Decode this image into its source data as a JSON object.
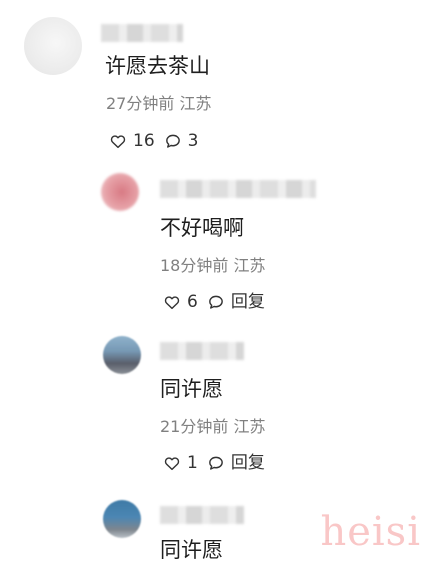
{
  "comments": [
    {
      "text": "许愿去茶山",
      "meta": "27分钟前 江苏",
      "actions": {
        "like_count": "16",
        "comment_count": "3"
      }
    }
  ],
  "replies": [
    {
      "text": "不好喝啊",
      "meta": "18分钟前 江苏",
      "actions": {
        "like_count": "6",
        "reply_label": "回复"
      }
    },
    {
      "text": "同许愿",
      "meta": "21分钟前 江苏",
      "actions": {
        "like_count": "1",
        "reply_label": "回复"
      }
    },
    {
      "text": "同许愿"
    }
  ],
  "watermark": "heisi",
  "icons": {
    "like": "heart-outline-icon",
    "comment": "speech-bubble-icon",
    "reply": "reply-bubble-icon"
  },
  "colors": {
    "primary_text": "#1f1f1f",
    "secondary_text": "#808080",
    "watermark": "#f07a7a"
  }
}
